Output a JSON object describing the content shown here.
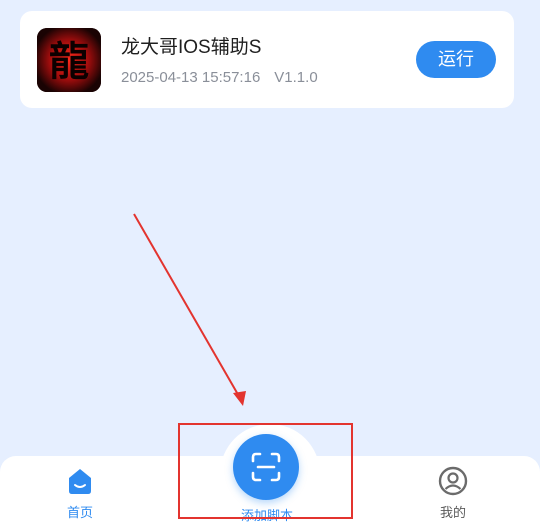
{
  "script_card": {
    "title": "龙大哥IOS辅助S",
    "date": "2025-04-13 15:57:16",
    "version": "V1.1.0",
    "run_button": "运行",
    "icon_glyph": "龍"
  },
  "bottom_nav": {
    "home_label": "首页",
    "add_script_label": "添加脚本",
    "mine_label": "我的"
  },
  "colors": {
    "accent": "#2f8bf0",
    "background": "#e6efff",
    "annotation": "#e3342f"
  }
}
